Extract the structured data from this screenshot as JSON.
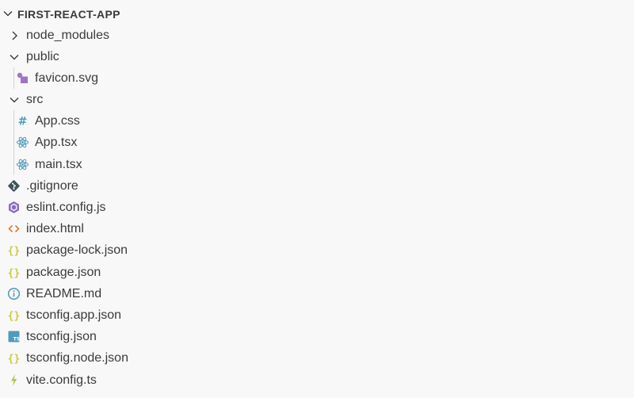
{
  "explorer": {
    "section_title": "FIRST-REACT-APP",
    "items": [
      {
        "label": "node_modules",
        "kind": "folder",
        "expanded": false,
        "depth": 0,
        "icon": "chevron-right-icon"
      },
      {
        "label": "public",
        "kind": "folder",
        "expanded": true,
        "depth": 0,
        "icon": "chevron-down-icon"
      },
      {
        "label": "favicon.svg",
        "kind": "file",
        "depth": 1,
        "icon": "svg-file-icon"
      },
      {
        "label": "src",
        "kind": "folder",
        "expanded": true,
        "depth": 0,
        "icon": "chevron-down-icon"
      },
      {
        "label": "App.css",
        "kind": "file",
        "depth": 1,
        "icon": "css-hash-icon"
      },
      {
        "label": "App.tsx",
        "kind": "file",
        "depth": 1,
        "icon": "react-icon"
      },
      {
        "label": "main.tsx",
        "kind": "file",
        "depth": 1,
        "icon": "react-icon"
      },
      {
        "label": ".gitignore",
        "kind": "file",
        "depth": 0,
        "icon": "git-icon"
      },
      {
        "label": "eslint.config.js",
        "kind": "file",
        "depth": 0,
        "icon": "eslint-icon"
      },
      {
        "label": "index.html",
        "kind": "file",
        "depth": 0,
        "icon": "html-code-icon"
      },
      {
        "label": "package-lock.json",
        "kind": "file",
        "depth": 0,
        "icon": "json-braces-icon"
      },
      {
        "label": "package.json",
        "kind": "file",
        "depth": 0,
        "icon": "json-braces-icon"
      },
      {
        "label": "README.md",
        "kind": "file",
        "depth": 0,
        "icon": "info-icon"
      },
      {
        "label": "tsconfig.app.json",
        "kind": "file",
        "depth": 0,
        "icon": "json-braces-icon"
      },
      {
        "label": "tsconfig.json",
        "kind": "file",
        "depth": 0,
        "icon": "typescript-icon"
      },
      {
        "label": "tsconfig.node.json",
        "kind": "file",
        "depth": 0,
        "icon": "json-braces-icon"
      },
      {
        "label": "vite.config.ts",
        "kind": "file",
        "depth": 0,
        "icon": "vite-bolt-icon"
      }
    ]
  },
  "colors": {
    "background": "#f8f8f8",
    "text": "#3b3b3b",
    "svg_icon": "#a074c4",
    "css_icon": "#519aba",
    "react_icon": "#519aba",
    "git_icon": "#41535b",
    "eslint_icon": "#8d6ac8",
    "html_icon": "#e37933",
    "json_icon": "#cbcb41",
    "info_icon": "#519aba",
    "ts_icon": "#519aba",
    "vite_icon": "#b8c53a"
  }
}
